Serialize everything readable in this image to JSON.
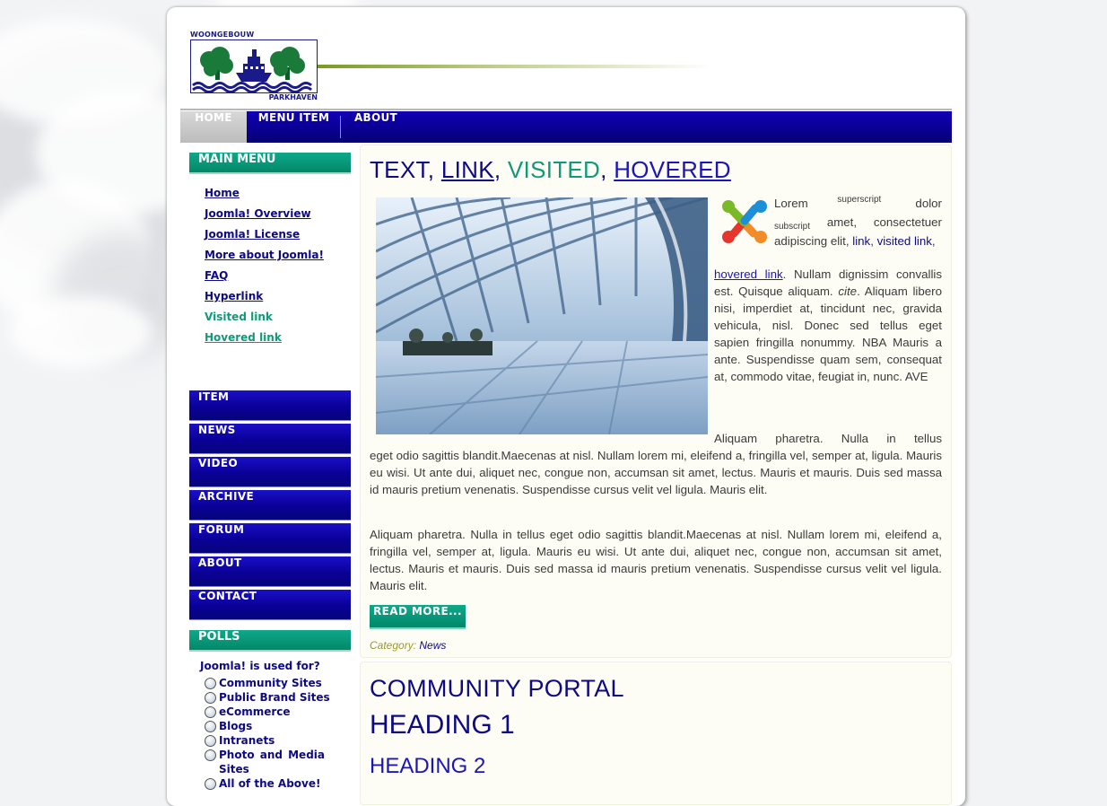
{
  "header": {
    "logo_top": "WOONGEBOUW",
    "logo_bottom": "PARKHAVEN"
  },
  "topnav": {
    "items": [
      {
        "label": "HOME",
        "active": true
      },
      {
        "label": "MENU ITEM",
        "active": false
      },
      {
        "label": "ABOUT",
        "active": false
      }
    ]
  },
  "sidebar": {
    "main_menu_title": "MAIN MENU",
    "main_menu": [
      {
        "label": "Home",
        "state": "link"
      },
      {
        "label": "Joomla! Overview",
        "state": "link"
      },
      {
        "label": "Joomla! License",
        "state": "link"
      },
      {
        "label": "More about Joomla!",
        "state": "link"
      },
      {
        "label": "FAQ",
        "state": "link"
      },
      {
        "label": "Hyperlink",
        "state": "link"
      },
      {
        "label": "Visited link",
        "state": "visited"
      },
      {
        "label": "Hovered link",
        "state": "hovered"
      }
    ],
    "buttons": [
      "ITEM",
      "NEWS",
      "VIDEO",
      "ARCHIVE",
      "FORUM",
      "ABOUT",
      "CONTACT"
    ],
    "polls_title": "POLLS",
    "poll": {
      "question": "Joomla! is used for?",
      "options": [
        "Community Sites",
        "Public Brand Sites",
        "eCommerce",
        "Blogs",
        "Intranets",
        "Photo and Media Sites",
        "All of the Above!"
      ]
    }
  },
  "article": {
    "title_text": "TEXT",
    "title_link": "LINK",
    "title_visited": "VISITED",
    "title_hovered": "HOVERED",
    "p1": {
      "lorem": "Lorem",
      "sup": "superscript",
      "dolor": "dolor",
      "sub": "subscript",
      "amet": "amet, consectetuer adipiscing elit,",
      "link": "link",
      "visited": "visited link",
      "hovered": "hovered link",
      "rest1": ". Nullam dignissim convallis est. Quisque aliquam.",
      "cite": "cite",
      "rest2": ". Aliquam libero nisi, imperdiet at, tincidunt nec, gravida vehicula, nisl. Donec sed tellus eget sapien fringilla nonummy. NBA Mauris a ante. Suspendisse quam sem, consequat at, commodo vitae, feugiat in, nunc. AVE"
    },
    "p2a": "Aliquam pharetra. Nulla in tellus",
    "p2b": "eget odio sagittis blandit.Maecenas at nisl. Nullam lorem mi, eleifend a, fringilla vel, semper at, ligula. Mauris eu wisi. Ut ante dui, aliquet nec, congue non, accumsan sit amet, lectus. Mauris et mauris. Duis sed massa id mauris pretium venenatis. Suspendisse cursus velit vel ligula. Mauris elit.",
    "p3": "Aliquam pharetra. Nulla in tellus eget odio sagittis blandit.Maecenas at nisl. Nullam lorem mi, eleifend a, fringilla vel, semper at, ligula. Mauris eu wisi. Ut ante dui, aliquet nec, congue non, accumsan sit amet, lectus. Mauris et mauris. Duis sed massa id mauris pretium venenatis. Suspendisse cursus velit vel ligula. Mauris elit.",
    "read_more": "READ MORE...",
    "category_label": "Category:",
    "category_value": "News"
  },
  "second": {
    "portal": "COMMUNITY PORTAL",
    "h1": "HEADING 1",
    "h2": "HEADING 2"
  },
  "colors": {
    "nav_blue": "#0a0096",
    "accent_green": "#018869",
    "link_blue": "#0d0a84",
    "visited_green": "#119a78"
  }
}
